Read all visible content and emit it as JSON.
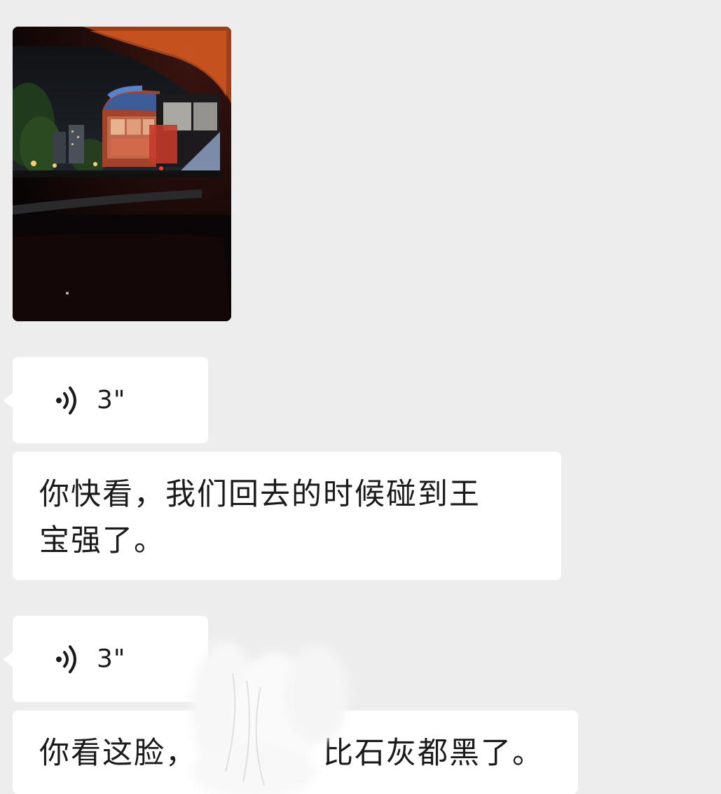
{
  "messages": [
    {
      "type": "image",
      "alt_icon": "photo-night-bus-through-car-window"
    },
    {
      "type": "voice",
      "duration": "3\"",
      "icon": "voice-wave-icon"
    },
    {
      "type": "text",
      "lines": [
        "你快看，我们回去的时候碰到王",
        "宝强了。"
      ]
    },
    {
      "type": "voice",
      "duration": "3\"",
      "icon": "voice-wave-icon"
    },
    {
      "type": "text",
      "before_smudge": "你看这脸，",
      "after_smudge": "比石灰都黑了。"
    }
  ],
  "colors": {
    "background": "#ededed",
    "bubble": "#ffffff",
    "text": "#1a1a1a"
  }
}
